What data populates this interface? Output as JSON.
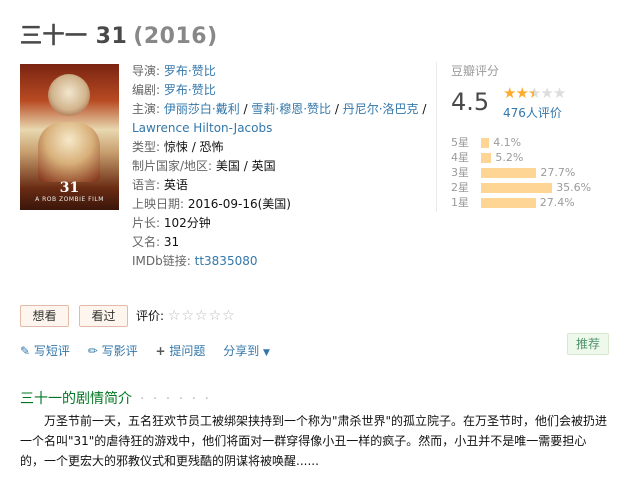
{
  "header": {
    "title": "三十一 31",
    "year": "(2016)"
  },
  "poster": {
    "big_text": "31",
    "small_text": "A ROB ZOMBIE FILM"
  },
  "info": {
    "director_label": "导演:",
    "director": "罗布·赞比",
    "writer_label": "编剧:",
    "writer": "罗布·赞比",
    "cast_label": "主演:",
    "cast": [
      "伊丽莎白·戴利",
      "雪莉·穆恩·赞比",
      "丹尼尔·洛巴克",
      "Lawrence Hilton-Jacobs"
    ],
    "genre_label": "类型:",
    "genre": "惊悚 / 恐怖",
    "country_label": "制片国家/地区:",
    "country": "美国 / 英国",
    "language_label": "语言:",
    "language": "英语",
    "release_label": "上映日期:",
    "release": "2016-09-16(美国)",
    "runtime_label": "片长:",
    "runtime": "102分钟",
    "aka_label": "又名:",
    "aka": "31",
    "imdb_label": "IMDb链接:",
    "imdb": "tt3835080"
  },
  "rating": {
    "title": "豆瓣评分",
    "score": "4.5",
    "stars_value": 2.5,
    "count_text": "476人评价",
    "bars": [
      {
        "label": "5星",
        "pct_text": "4.1%",
        "pct": 4.1
      },
      {
        "label": "4星",
        "pct_text": "5.2%",
        "pct": 5.2
      },
      {
        "label": "3星",
        "pct_text": "27.7%",
        "pct": 27.7
      },
      {
        "label": "2星",
        "pct_text": "35.6%",
        "pct": 35.6
      },
      {
        "label": "1星",
        "pct_text": "27.4%",
        "pct": 27.4
      }
    ]
  },
  "buttons": {
    "want": "想看",
    "seen": "看过",
    "rate_label": "评价:"
  },
  "actions": {
    "short_review": "写短评",
    "review": "写影评",
    "ask": "提问题",
    "share": "分享到"
  },
  "recommend": "推荐",
  "synopsis": {
    "title": "三十一的剧情简介",
    "dots": "· · · · · ·",
    "text": "万圣节前一天，五名狂欢节员工被绑架挟持到一个称为\"肃杀世界\"的孤立院子。在万圣节时，他们会被扔进一个名叫\"31\"的虐待狂的游戏中，他们将面对一群穿得像小丑一样的疯子。然而，小丑并不是唯一需要担心的，一个更宏大的邪教仪式和更残酷的阴谋将被唤醒......"
  },
  "colors": {
    "link": "#3377aa",
    "green": "#007722",
    "bar": "#ffd596",
    "star": "#ffac2d"
  }
}
